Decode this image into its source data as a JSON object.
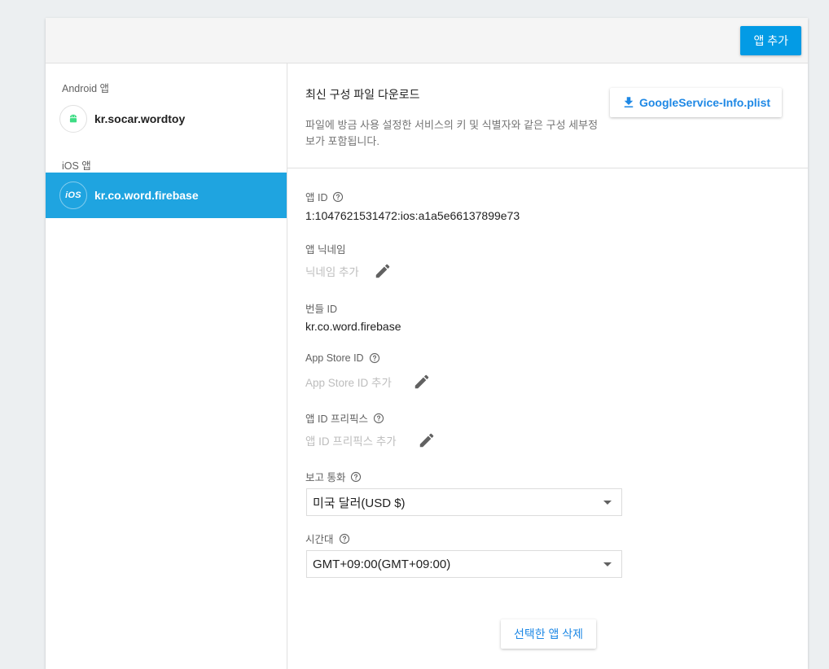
{
  "header": {
    "add_app_label": "앱 추가"
  },
  "sidebar": {
    "android_label": "Android 앱",
    "android_app": "kr.socar.wordtoy",
    "ios_label": "iOS 앱",
    "ios_badge": "iOS",
    "ios_app": "kr.co.word.firebase"
  },
  "download": {
    "title": "최신 구성 파일 다운로드",
    "description": "파일에 방금 사용 설정한 서비스의 키 및 식별자와 같은 구성 세부정보가 포함됩니다.",
    "button_label": "GoogleService-Info.plist"
  },
  "fields": {
    "app_id_label": "앱 ID",
    "app_id_value": "1:1047621531472:ios:a1a5e66137899e73",
    "nickname_label": "앱 닉네임",
    "nickname_placeholder": "닉네임 추가",
    "bundle_label": "번들 ID",
    "bundle_value": "kr.co.word.firebase",
    "appstore_label": "App Store ID",
    "appstore_placeholder": "App Store ID 추가",
    "prefix_label": "앱 ID 프리픽스",
    "prefix_placeholder": "앱 ID 프리픽스 추가",
    "currency_label": "보고 통화",
    "currency_value": "미국 달러(USD $)",
    "timezone_label": "시간대",
    "timezone_value": "GMT+09:00(GMT+09:00)"
  },
  "delete_label": "선택한 앱 삭제",
  "colors": {
    "accent": "#039be5",
    "selected": "#1fa4e0",
    "android_green": "#3ddc84"
  }
}
